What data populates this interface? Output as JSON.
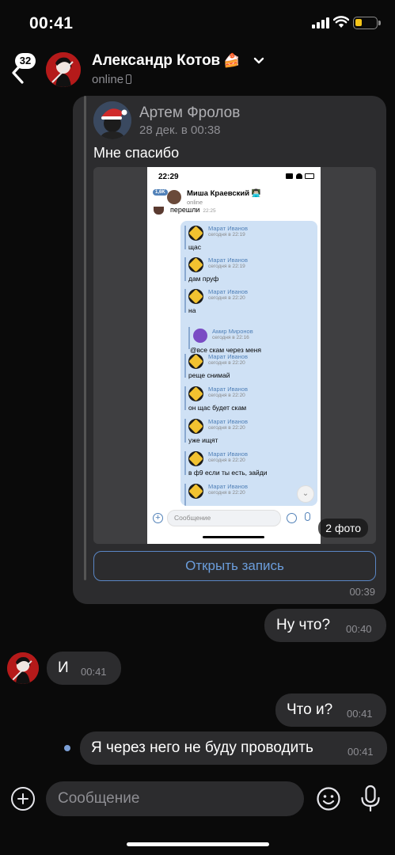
{
  "status_bar": {
    "time": "00:41"
  },
  "header": {
    "back_count": "32",
    "name": "Александр Котов",
    "name_emoji": "🍰",
    "status": "online"
  },
  "forwarded_post": {
    "author": "Артем Фролов",
    "date": "28 дек. в 00:38",
    "text": "Мне спасибо",
    "photo_count": "2 фото",
    "open_button": "Открыть запись",
    "time": "00:39",
    "screenshot": {
      "time": "22:29",
      "chat_name": "Миша Краевский 👨🏻‍💻",
      "chat_status": "online",
      "back_badge": "1,6K",
      "prev_message": "перешли",
      "prev_time": "22:25",
      "messages": [
        {
          "name": "Марат Иванов",
          "time": "сегодня в 22:19",
          "text": "щас"
        },
        {
          "name": "Марат Иванов",
          "time": "сегодня в 22:19",
          "text": "дам пруф"
        },
        {
          "name": "Марат Иванов",
          "time": "сегодня в 22:20",
          "text": "на"
        },
        {
          "name": "Марат Иванов",
          "time": "сегодня в 22:20",
          "text": "реще снимай"
        },
        {
          "name": "Марат Иванов",
          "time": "сегодня в 22:20",
          "text": "он щас будет скам"
        },
        {
          "name": "Марат Иванов",
          "time": "сегодня в 22:20",
          "text": "уже ищят"
        },
        {
          "name": "Марат Иванов",
          "time": "сегодня в 22:20",
          "text": "в ф9 если ты есть, зайди"
        },
        {
          "name": "Марат Иванов",
          "time": "сегодня в 22:20",
          "text": ""
        }
      ],
      "nested": {
        "name": "Амир Миронов",
        "time": "сегодня в 22:16",
        "text": "@все скам через меня"
      },
      "input_placeholder": "Сообщение"
    }
  },
  "messages": [
    {
      "direction": "out",
      "text": "Ну что?",
      "time": "00:40"
    },
    {
      "direction": "in",
      "text": "И",
      "time": "00:41"
    },
    {
      "direction": "out",
      "text": "Что и?",
      "time": "00:41"
    },
    {
      "direction": "out",
      "text": "Я через него не буду проводить",
      "time": "00:41",
      "unread": true
    }
  ],
  "composer": {
    "placeholder": "Сообщение"
  }
}
